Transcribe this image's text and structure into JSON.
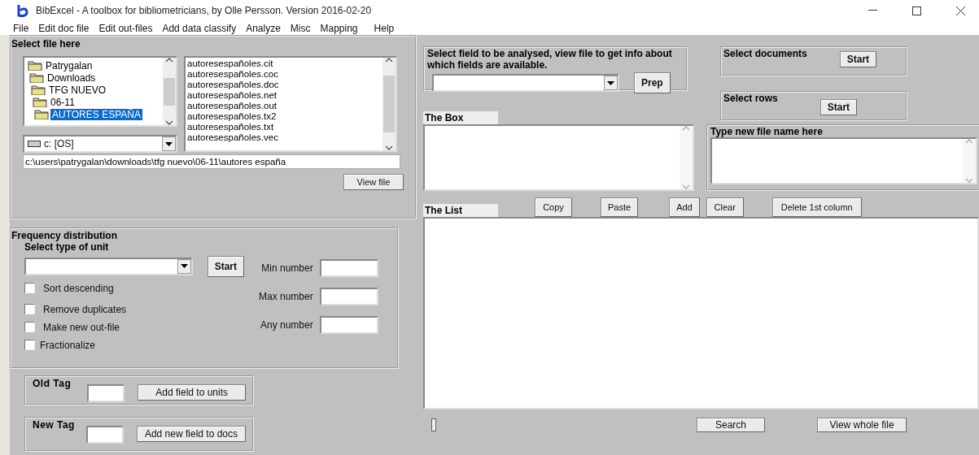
{
  "window": {
    "title": "BibExcel - A toolbox for bibliometricians, by Olle Persson. Version 2016-02-20"
  },
  "menu": [
    "File",
    "Edit doc file",
    "Edit out-files",
    "Add data classify",
    "Analyze",
    "Misc",
    "Mapping",
    "Help"
  ],
  "select_file": {
    "title": "Select file here",
    "folders": [
      {
        "label": "Patrygalan",
        "selected": false,
        "children": [
          {
            "label": "Downloads",
            "selected": false,
            "children": [
              {
                "label": "TFG NUEVO",
                "selected": false,
                "children": [
                  {
                    "label": "06-11",
                    "selected": false,
                    "children": [
                      {
                        "label": "AUTORES ESPAÑA",
                        "selected": true
                      }
                    ]
                  }
                ]
              }
            ]
          }
        ]
      }
    ],
    "drive": "c: [OS]",
    "files": [
      "autoresespañoles.cit",
      "autoresespañoles.coc",
      "autoresespañoles.doc",
      "autoresespañoles.net",
      "autoresespañoles.out",
      "autoresespañoles.tx2",
      "autoresespañoles.txt",
      "autoresespañoles.vec"
    ],
    "path": "c:\\users\\patrygalan\\downloads\\tfg nuevo\\06-11\\autores españa",
    "view_button": "View file"
  },
  "frequency": {
    "title": "Frequency distribution",
    "unit_label": "Select type of unit",
    "start": "Start",
    "options": [
      {
        "label": "Sort descending",
        "checked": false
      },
      {
        "label": "Remove duplicates",
        "checked": false
      },
      {
        "label": "Make new out-file",
        "checked": false
      },
      {
        "label": "Fractionalize",
        "checked": false
      }
    ],
    "numbers": [
      "Min number",
      "Max number",
      "Any number"
    ]
  },
  "tags": [
    {
      "label": "Old Tag",
      "button": "Add field to units"
    },
    {
      "label": "New Tag",
      "button": "Add new field to docs"
    }
  ],
  "field_select": {
    "label": "Select field to be analysed, view file to get info about which fields are available.",
    "button": "Prep"
  },
  "selectors": [
    {
      "label": "Select documents",
      "button": "Start"
    },
    {
      "label": "Select rows",
      "button": "Start"
    }
  ],
  "box": {
    "label": "The Box"
  },
  "new_file": {
    "label": "Type new file name here"
  },
  "list": {
    "label": "The List",
    "buttons": [
      "Copy",
      "Paste",
      "Add",
      "Clear",
      "Delete 1st column"
    ]
  },
  "bottom_buttons": [
    "Search",
    "View whole file"
  ]
}
